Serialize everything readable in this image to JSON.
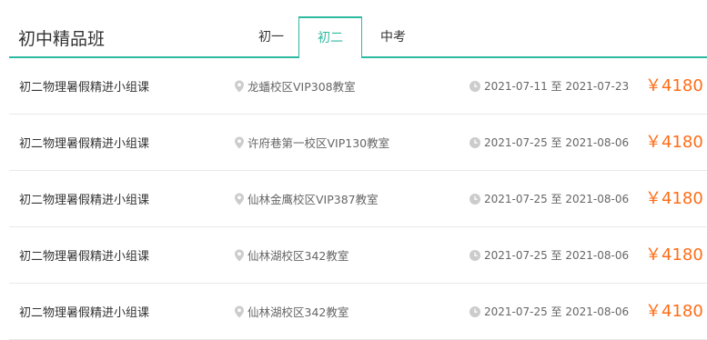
{
  "header": {
    "title": "初中精品班",
    "tabs": [
      {
        "label": "初一",
        "active": false
      },
      {
        "label": "初二",
        "active": true
      },
      {
        "label": "中考",
        "active": false
      }
    ]
  },
  "colors": {
    "accent": "#2ebaa1",
    "price": "#ff6d17",
    "divider": "#e8e8e8"
  },
  "courses": [
    {
      "name": "初二物理暑假精进小组课",
      "location": "龙蟠校区VIP308教室",
      "date_range": "2021-07-11 至 2021-07-23",
      "price": "￥4180"
    },
    {
      "name": "初二物理暑假精进小组课",
      "location": "许府巷第一校区VIP130教室",
      "date_range": "2021-07-25 至 2021-08-06",
      "price": "￥4180"
    },
    {
      "name": "初二物理暑假精进小组课",
      "location": "仙林金鹰校区VIP387教室",
      "date_range": "2021-07-25 至 2021-08-06",
      "price": "￥4180"
    },
    {
      "name": "初二物理暑假精进小组课",
      "location": "仙林湖校区342教室",
      "date_range": "2021-07-25 至 2021-08-06",
      "price": "￥4180"
    },
    {
      "name": "初二物理暑假精进小组课",
      "location": "仙林湖校区342教室",
      "date_range": "2021-07-25 至 2021-08-06",
      "price": "￥4180"
    }
  ],
  "icons": {
    "location": "map-pin-icon",
    "time": "clock-icon"
  }
}
